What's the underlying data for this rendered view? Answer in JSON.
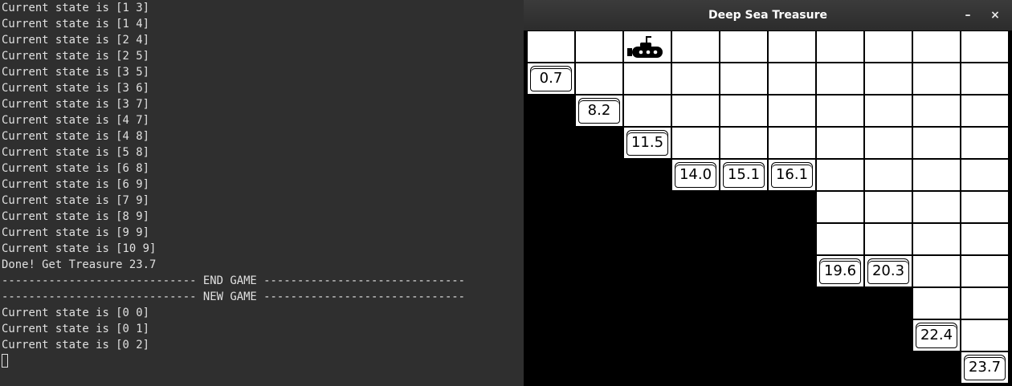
{
  "terminal": {
    "lines": [
      "Current state is [1 3]",
      "Current state is [1 4]",
      "Current state is [2 4]",
      "Current state is [2 5]",
      "Current state is [3 5]",
      "Current state is [3 6]",
      "Current state is [3 7]",
      "Current state is [4 7]",
      "Current state is [4 8]",
      "Current state is [5 8]",
      "Current state is [6 8]",
      "Current state is [6 9]",
      "Current state is [7 9]",
      "Current state is [8 9]",
      "Current state is [9 9]",
      "Current state is [10 9]",
      "Done! Get Treasure 23.7",
      "----------------------------- END GAME ------------------------------",
      "----------------------------- NEW GAME ------------------------------",
      "Current state is [0 0]",
      "Current state is [0 1]",
      "Current state is [0 2]"
    ]
  },
  "window": {
    "title": "Deep Sea Treasure",
    "minimize_label": "–",
    "close_label": "×"
  },
  "grid": {
    "columns": 10,
    "rows": 11,
    "submarine": {
      "row": 0,
      "col": 2,
      "icon": "submarine-icon"
    },
    "treasures": [
      {
        "row": 1,
        "col": 0,
        "value": "0.7"
      },
      {
        "row": 2,
        "col": 1,
        "value": "8.2"
      },
      {
        "row": 3,
        "col": 2,
        "value": "11.5"
      },
      {
        "row": 4,
        "col": 3,
        "value": "14.0"
      },
      {
        "row": 4,
        "col": 4,
        "value": "15.1"
      },
      {
        "row": 4,
        "col": 5,
        "value": "16.1"
      },
      {
        "row": 7,
        "col": 6,
        "value": "19.6"
      },
      {
        "row": 7,
        "col": 7,
        "value": "20.3"
      },
      {
        "row": 9,
        "col": 8,
        "value": "22.4"
      },
      {
        "row": 10,
        "col": 9,
        "value": "23.7"
      }
    ],
    "sea_depth_per_column": [
      1,
      2,
      3,
      4,
      4,
      4,
      7,
      7,
      9,
      10
    ],
    "colors": {
      "sea": "#ffffff",
      "floor": "#000000",
      "titlebar": "#333333",
      "terminal_bg": "#2f2f2f"
    }
  }
}
